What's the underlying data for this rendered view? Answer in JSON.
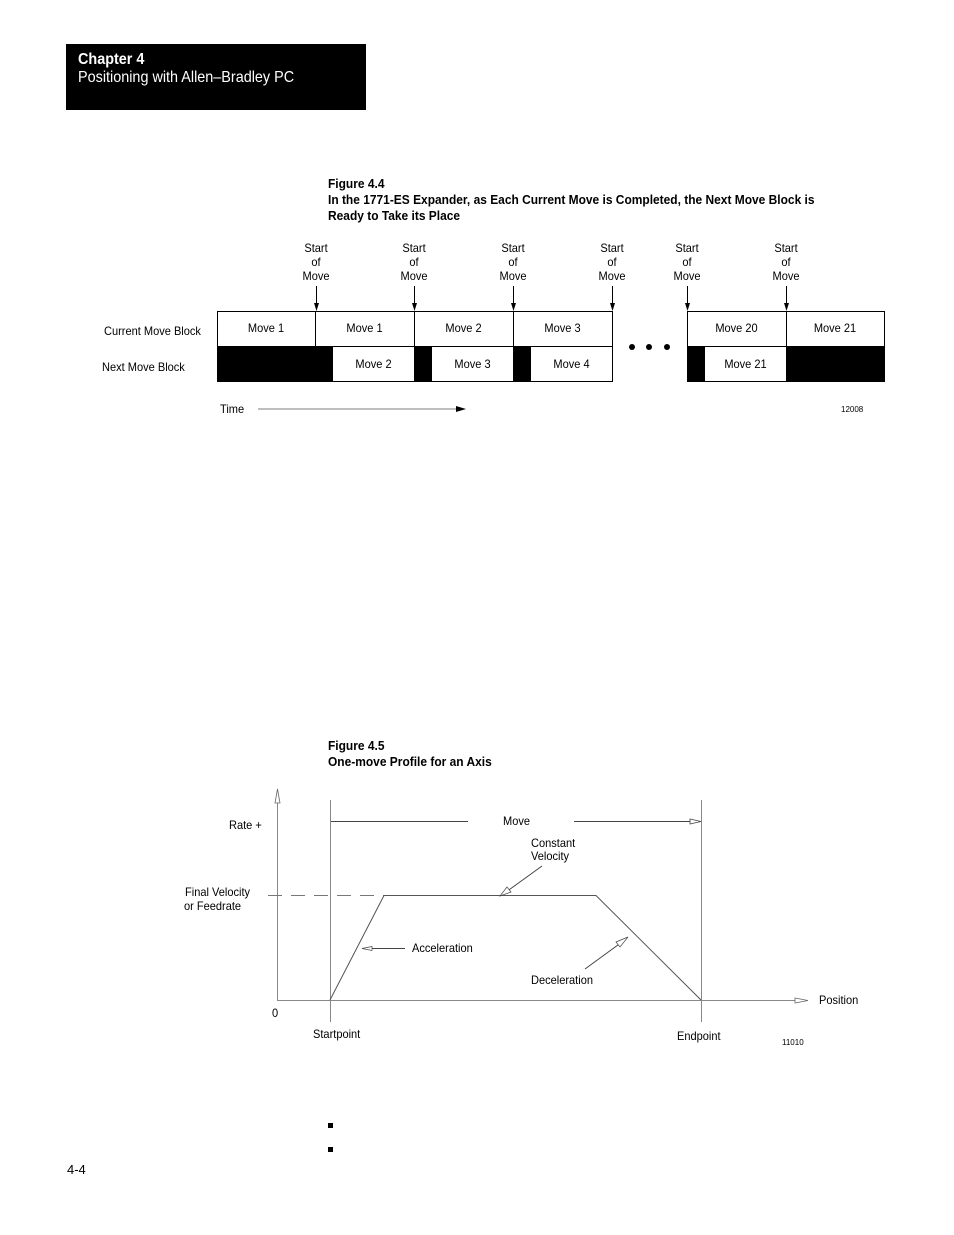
{
  "header": {
    "chapter": "Chapter 4",
    "title": "Positioning with Allen–Bradley PC"
  },
  "figure_4_4": {
    "number": "Figure 4.4",
    "caption_line1": "In the 1771-ES Expander, as Each Current Move is Completed, the Next Move Block is",
    "caption_line2": "Ready to Take its Place",
    "row_labels": {
      "current": "Current Move Block",
      "next": "Next Move Block"
    },
    "start_marker": [
      "Start",
      "of",
      "Move"
    ],
    "current_blocks": [
      "Move 1",
      "Move 1",
      "Move 2",
      "Move 3",
      "Move 20",
      "Move 21"
    ],
    "next_blocks": [
      "Move 2",
      "Move 3",
      "Move 4",
      "Move 21"
    ],
    "ellipsis": "•  •  •",
    "time_label": "Time",
    "figure_id": "12008"
  },
  "figure_4_5": {
    "number": "Figure 4.5",
    "caption": "One-move Profile for an Axis",
    "labels": {
      "rate": "Rate +",
      "final_velocity_1": "Final Velocity",
      "final_velocity_2": "or Feedrate",
      "zero": "0",
      "move": "Move",
      "constant_velocity_1": "Constant",
      "constant_velocity_2": "Velocity",
      "acceleration": "Acceleration",
      "deceleration": "Deceleration",
      "position": "Position",
      "startpoint": "Startpoint",
      "endpoint": "Endpoint"
    },
    "figure_id": "11010"
  },
  "page_number": "4-4"
}
